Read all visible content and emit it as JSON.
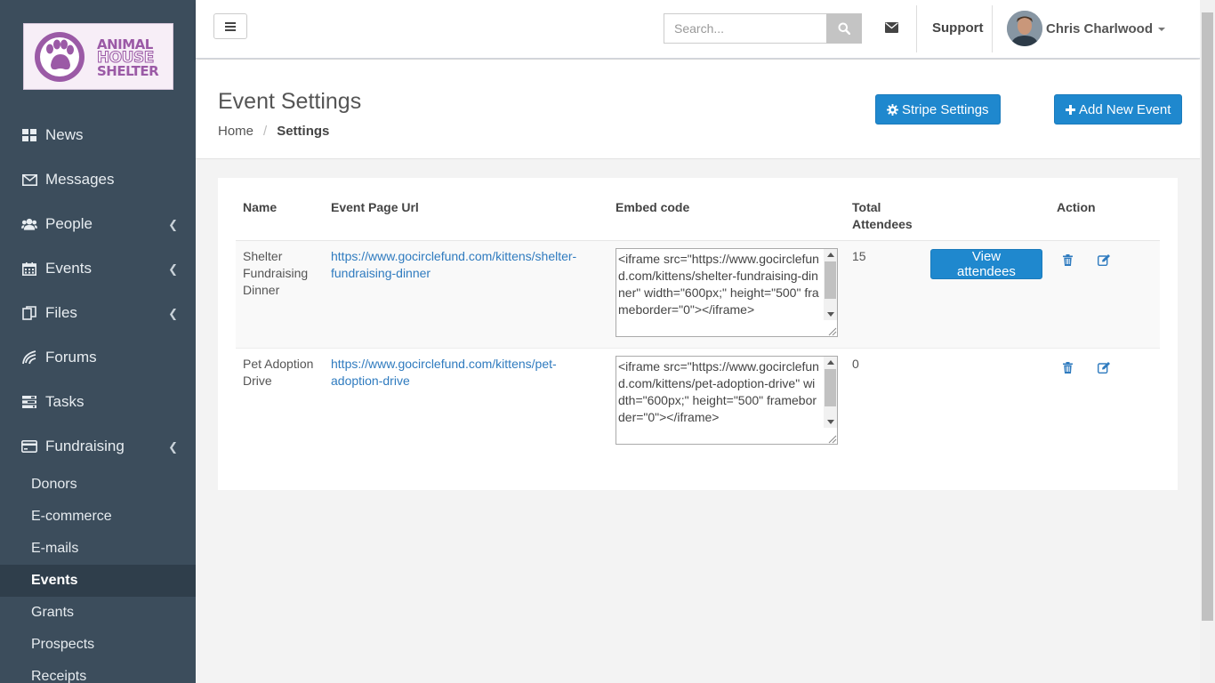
{
  "logo": {
    "line1": "ANIMAL",
    "line2": "HOUSE",
    "line3": "SHELTER"
  },
  "sidebar": {
    "items": [
      {
        "label": "News",
        "icon": "dashboard-icon"
      },
      {
        "label": "Messages",
        "icon": "envelope-icon"
      },
      {
        "label": "People",
        "icon": "users-icon"
      },
      {
        "label": "Events",
        "icon": "calendar-icon"
      },
      {
        "label": "Files",
        "icon": "files-icon"
      },
      {
        "label": "Forums",
        "icon": "forums-icon"
      },
      {
        "label": "Tasks",
        "icon": "tasks-icon"
      },
      {
        "label": "Fundraising",
        "icon": "credit-card-icon"
      }
    ],
    "sub_items": [
      "Donors",
      "E-commerce",
      "E-mails",
      "Events",
      "Grants",
      "Prospects",
      "Receipts"
    ],
    "active_sub": "Events"
  },
  "topbar": {
    "search_placeholder": "Search...",
    "support_label": "Support",
    "user_name": "Chris Charlwood"
  },
  "header": {
    "title": "Event Settings",
    "breadcrumb_home": "Home",
    "breadcrumb_current": "Settings",
    "stripe_button": "Stripe Settings",
    "add_button": "Add New Event"
  },
  "table": {
    "headers": {
      "name": "Name",
      "url": "Event Page Url",
      "embed": "Embed code",
      "total_line1": "Total",
      "total_line2": "Attendees",
      "action": "Action"
    },
    "view_label": "View attendees",
    "rows": [
      {
        "name": "Shelter Fundraising Dinner",
        "url": "https://www.gocirclefund.com/kittens/shelter-fundraising-dinner",
        "embed": "<iframe src=\"https://www.gocirclefund.com/kittens/shelter-fundraising-dinner\" width=\"600px;\" height=\"500\" frameborder=\"0\"></iframe>",
        "total": "15"
      },
      {
        "name": "Pet Adoption Drive",
        "url": "https://www.gocirclefund.com/kittens/pet-adoption-drive",
        "embed": "<iframe src=\"https://www.gocirclefund.com/kittens/pet-adoption-drive\" width=\"600px;\" height=\"500\" frameborder=\"0\"></iframe>",
        "total": "0"
      }
    ]
  },
  "colors": {
    "sidebar_bg": "#3c4d5c",
    "accent": "#1f88ce",
    "link": "#2f7bbf"
  }
}
